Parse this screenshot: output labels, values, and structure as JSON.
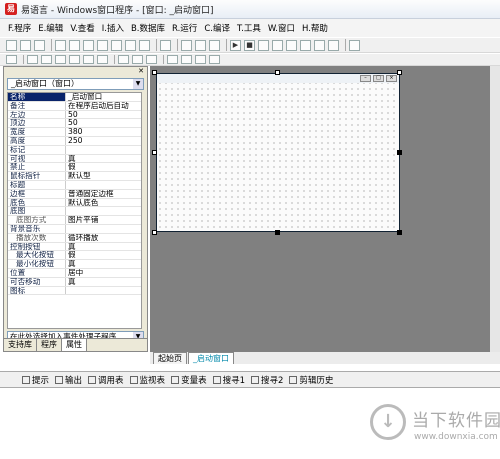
{
  "window": {
    "title": "易语言 - Windows窗口程序 - [窗口: _启动窗口]"
  },
  "menu": [
    "F.程序",
    "E.编辑",
    "V.查看",
    "I.插入",
    "B.数据库",
    "R.运行",
    "C.编译",
    "T.工具",
    "W.窗口",
    "H.帮助"
  ],
  "left_panel": {
    "combo": "_启动窗口（窗口）",
    "properties": [
      {
        "name": "名称",
        "value": "_启动窗口"
      },
      {
        "name": "备注",
        "value": "在程序启动后自动"
      },
      {
        "name": "左边",
        "value": "50"
      },
      {
        "name": "顶边",
        "value": "50"
      },
      {
        "name": "宽度",
        "value": "380"
      },
      {
        "name": "高度",
        "value": "250"
      },
      {
        "name": "标记",
        "value": ""
      },
      {
        "name": "可视",
        "value": "真"
      },
      {
        "name": "禁止",
        "value": "假"
      },
      {
        "name": "鼠标指针",
        "value": "默认型"
      },
      {
        "name": "标题",
        "value": ""
      },
      {
        "name": "边框",
        "value": "普通固定边框"
      },
      {
        "name": "底色",
        "value": "默认底色"
      },
      {
        "name": "底图",
        "value": ""
      },
      {
        "name": "底图方式",
        "value": "图片平铺"
      },
      {
        "name": "背景音乐",
        "value": ""
      },
      {
        "name": "播放次数",
        "value": "循环播放"
      },
      {
        "name": "控制按钮",
        "value": "真"
      },
      {
        "name": "最大化按钮",
        "value": "假"
      },
      {
        "name": "最小化按钮",
        "value": "真"
      },
      {
        "name": "位置",
        "value": "居中"
      },
      {
        "name": "可否移动",
        "value": "真"
      },
      {
        "name": "图标",
        "value": ""
      }
    ],
    "event_select": "在此处选择加入事件处理子程序",
    "tabs": [
      "支持库",
      "程序",
      "属性"
    ]
  },
  "doc_tabs": [
    "起始页",
    "_启动窗口"
  ],
  "output_tabs": [
    "提示",
    "输出",
    "调用表",
    "监视表",
    "变量表",
    "搜寻1",
    "搜寻2",
    "剪辑历史"
  ],
  "watermark": {
    "logo": "↓",
    "title": "当下软件园",
    "url": "www.downxia.com"
  }
}
